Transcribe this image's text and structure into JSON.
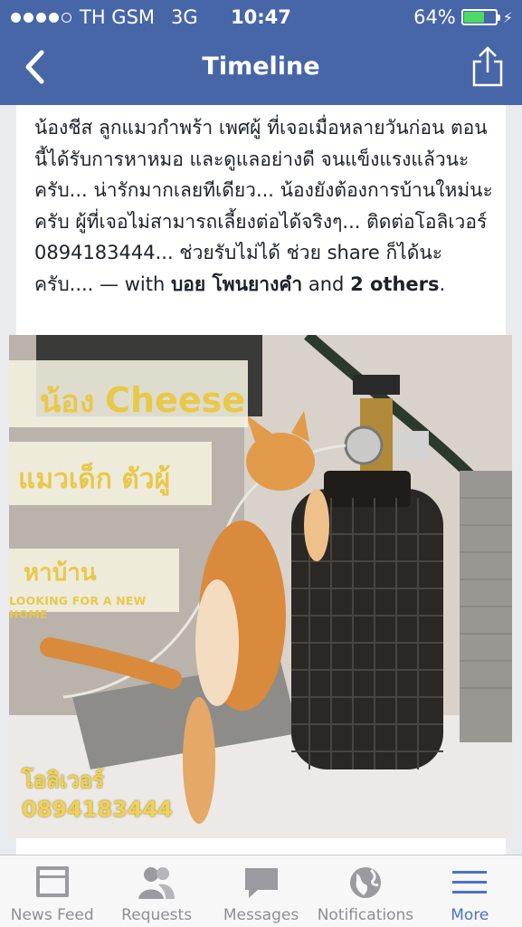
{
  "status_bar": {
    "carrier": "TH GSM",
    "network": "3G",
    "time": "10:47",
    "battery": "64%",
    "battery_level": 0.64
  },
  "nav": {
    "title": "Timeline",
    "back_icon": "chevron-left-icon",
    "share_icon": "share-icon"
  },
  "post": {
    "text": "น้องชีส ลูกแมวกำพร้า เพศผู้ ที่เจอเมื่อหลายวันก่อน ตอนนี้ได้รับการหาหมอ และดูแลอย่างดี จนแข็งแรงแล้วนะครับ... น่ารักมากเลยทีเดียว... น้องยังต้องการบ้านใหม่นะครับ ผู้ที่เจอไม่สามารถเลี้ยงต่อได้จริงๆ... ติดต่อโอลิเวอร์ 0894183444... ช่วยรับไม่ได้ ช่วย share ก็ได้นะครับ.... — with",
    "tagged_name": "บอย โพนยางคำ",
    "and_text": "and",
    "others_text": "2 others",
    "end": "."
  },
  "photo": {
    "overlay_name_prefix": "น้อง",
    "overlay_name": "Cheese",
    "overlay_type": "แมวเด็ก  ตัวผู้",
    "overlay_home": "หาบ้าน",
    "overlay_home_en": "LOOKING FOR A NEW HOME",
    "contact_name": "โอลิเวอร์",
    "contact_phone": "0894183444"
  },
  "tabs": [
    {
      "label": "News Feed",
      "icon": "news-feed-icon",
      "active": false
    },
    {
      "label": "Requests",
      "icon": "friend-requests-icon",
      "active": false
    },
    {
      "label": "Messages",
      "icon": "messages-icon",
      "active": false
    },
    {
      "label": "Notifications",
      "icon": "globe-icon",
      "active": false
    },
    {
      "label": "More",
      "icon": "menu-icon",
      "active": true
    }
  ],
  "colors": {
    "nav_bg": "#4766a8",
    "active_tab": "#4a72c7",
    "overlay_text": "#e8c84a"
  }
}
